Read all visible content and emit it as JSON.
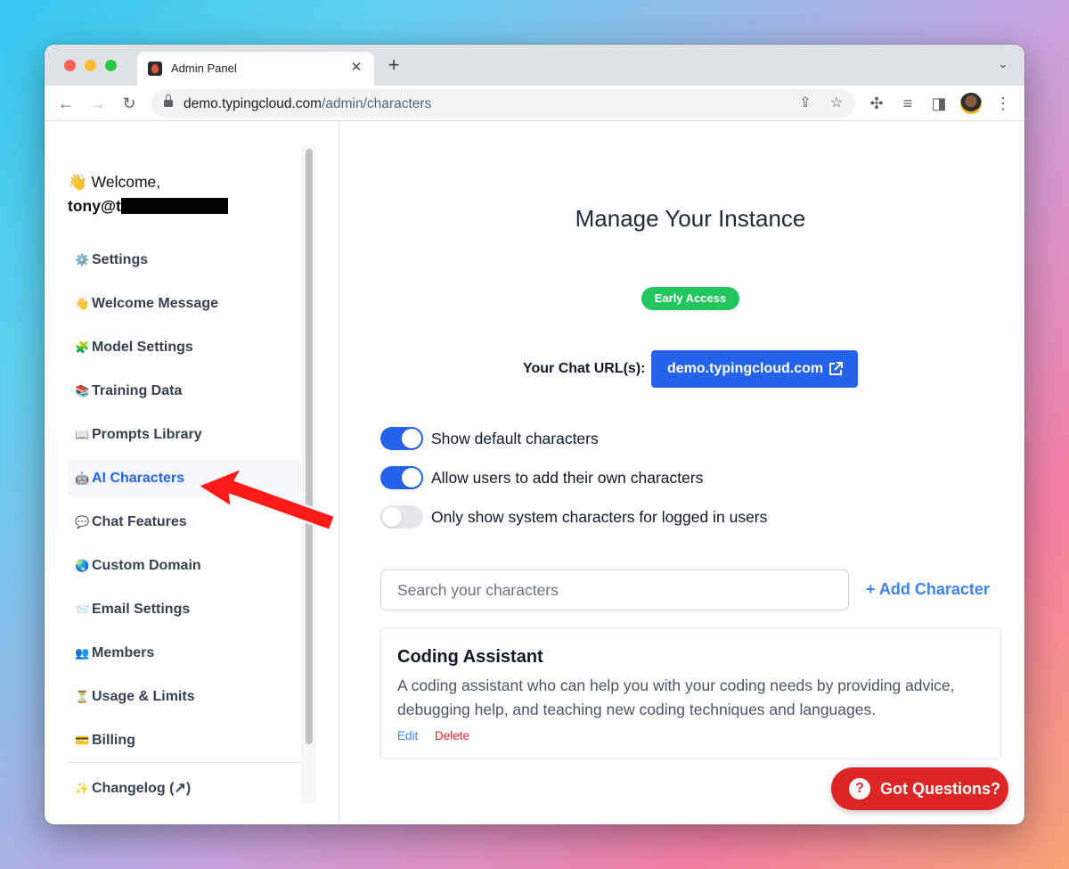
{
  "browser": {
    "tab_title": "Admin Panel",
    "url_domain": "demo.typingcloud.com",
    "url_path": "/admin/characters"
  },
  "sidebar": {
    "welcome": "👋 Welcome,",
    "user": "tony@t",
    "items": [
      {
        "emoji": "⚙️",
        "label": "Settings"
      },
      {
        "emoji": "👋",
        "label": "Welcome Message"
      },
      {
        "emoji": "🧩",
        "label": "Model Settings"
      },
      {
        "emoji": "📚",
        "label": "Training Data"
      },
      {
        "emoji": "📖",
        "label": "Prompts Library"
      },
      {
        "emoji": "🤖",
        "label": "AI Characters",
        "active": true
      },
      {
        "emoji": "💬",
        "label": "Chat Features"
      },
      {
        "emoji": "🌏",
        "label": "Custom Domain"
      },
      {
        "emoji": "📨",
        "label": "Email Settings"
      },
      {
        "emoji": "👥",
        "label": "Members"
      },
      {
        "emoji": "⏳",
        "label": "Usage & Limits"
      },
      {
        "emoji": "💳",
        "label": "Billing"
      }
    ],
    "changelog": {
      "emoji": "✨",
      "label": "Changelog (↗)"
    }
  },
  "main": {
    "title": "Manage Your Instance",
    "badge": "Early Access",
    "chat_url_label": "Your Chat URL(s):",
    "chat_url": "demo.typingcloud.com",
    "toggles": [
      {
        "label": "Show default characters",
        "on": true
      },
      {
        "label": "Allow users to add their own characters",
        "on": true
      },
      {
        "label": "Only show system characters for logged in users",
        "on": false
      }
    ],
    "search_placeholder": "Search your characters",
    "add_character": "+ Add Character",
    "characters": [
      {
        "name": "Coding Assistant",
        "description": "A coding assistant who can help you with your coding needs by providing advice, debugging help, and teaching new coding techniques and languages.",
        "edit": "Edit",
        "delete": "Delete"
      }
    ],
    "help_button": "Got Questions?"
  },
  "colors": {
    "accent": "#2563eb",
    "badge_green": "#22c55e",
    "danger": "#dc2626",
    "annotation_arrow": "#ff1a1a"
  }
}
